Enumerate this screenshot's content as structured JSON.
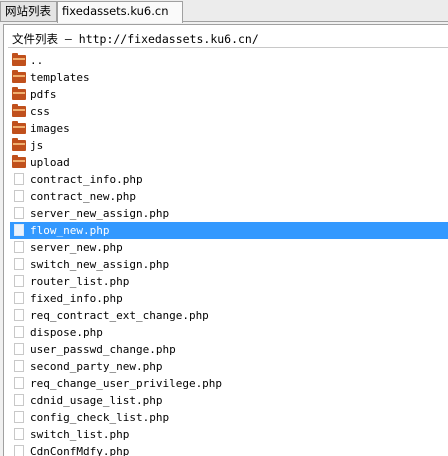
{
  "tabs": [
    {
      "label": "网站列表"
    },
    {
      "label": "fixedassets.ku6.cn"
    }
  ],
  "panel": {
    "title": "文件列表 — http://fixedassets.ku6.cn/"
  },
  "files": [
    {
      "name": "..",
      "type": "folder"
    },
    {
      "name": "templates",
      "type": "folder"
    },
    {
      "name": "pdfs",
      "type": "folder"
    },
    {
      "name": "css",
      "type": "folder"
    },
    {
      "name": "images",
      "type": "folder"
    },
    {
      "name": "js",
      "type": "folder"
    },
    {
      "name": "upload",
      "type": "folder"
    },
    {
      "name": "contract_info.php",
      "type": "file"
    },
    {
      "name": "contract_new.php",
      "type": "file"
    },
    {
      "name": "server_new_assign.php",
      "type": "file"
    },
    {
      "name": "flow_new.php",
      "type": "file",
      "selected": true
    },
    {
      "name": "server_new.php",
      "type": "file"
    },
    {
      "name": "switch_new_assign.php",
      "type": "file"
    },
    {
      "name": "router_list.php",
      "type": "file"
    },
    {
      "name": "fixed_info.php",
      "type": "file"
    },
    {
      "name": "req_contract_ext_change.php",
      "type": "file"
    },
    {
      "name": "dispose.php",
      "type": "file"
    },
    {
      "name": "user_passwd_change.php",
      "type": "file"
    },
    {
      "name": "second_party_new.php",
      "type": "file"
    },
    {
      "name": "req_change_user_privilege.php",
      "type": "file"
    },
    {
      "name": "cdnid_usage_list.php",
      "type": "file"
    },
    {
      "name": "config_check_list.php",
      "type": "file"
    },
    {
      "name": "switch_list.php",
      "type": "file"
    },
    {
      "name": "CdnConfMdfy.php",
      "type": "file"
    }
  ],
  "colors": {
    "selection": "#3399ff",
    "folder": "#c0501c"
  }
}
